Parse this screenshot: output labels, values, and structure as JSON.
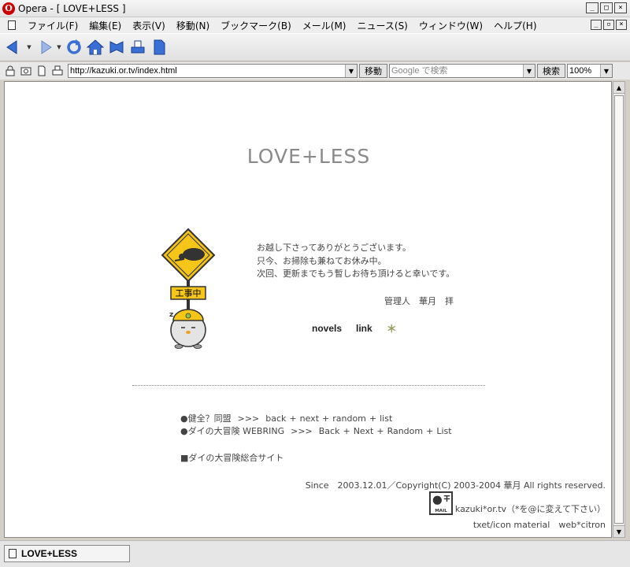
{
  "window": {
    "title": "Opera - [ LOVE+LESS ]",
    "app_icon": "opera-icon"
  },
  "menu": [
    "ファイル(F)",
    "編集(E)",
    "表示(V)",
    "移動(N)",
    "ブックマーク(B)",
    "メール(M)",
    "ニュース(S)",
    "ウィンドウ(W)",
    "ヘルプ(H)"
  ],
  "address": {
    "url": "http://kazuki.or.tv/index.html",
    "go_label": "移動",
    "search_placeholder": "Google で検索",
    "search_label": "検索",
    "zoom": "100%"
  },
  "page": {
    "title": "LOVE+LESS",
    "sign_text": "工事中",
    "message": [
      "お越し下さってありがとうございます。",
      "只今、お掃除も兼ねてお休み中。",
      "次回、更新までもう暫しお待ち頂けると幸いです。"
    ],
    "admin": "管理人　華月　拝",
    "nav": {
      "novels": "novels",
      "link": "link",
      "star": "＊"
    },
    "rings": [
      {
        "name": "●健全？同盟",
        "arrows": ">>>",
        "back": "back",
        "next": "next",
        "random": "random",
        "list": "list"
      },
      {
        "name": "●ダイの大冒険 WEBRING",
        "arrows": ">>>",
        "back": "Back",
        "next": "Next",
        "random": "Random",
        "list": "List"
      }
    ],
    "plus": "+",
    "site_link": "■ダイの大冒険総合サイト",
    "copyright": "Since　2003.12.01／Copyright(C) 2003-2004 華月 All rights reserved.",
    "mail_icon_text": "MAIL",
    "mail": "kazuki*or.tv（*を@に変えて下さい）",
    "material": "txet/icon material　web*citron"
  },
  "status": {
    "tab_label": "LOVE+LESS"
  },
  "colors": {
    "title_gray": "#8a8a8a",
    "sign_yellow": "#f5c518",
    "star": "#9a9a5a"
  }
}
